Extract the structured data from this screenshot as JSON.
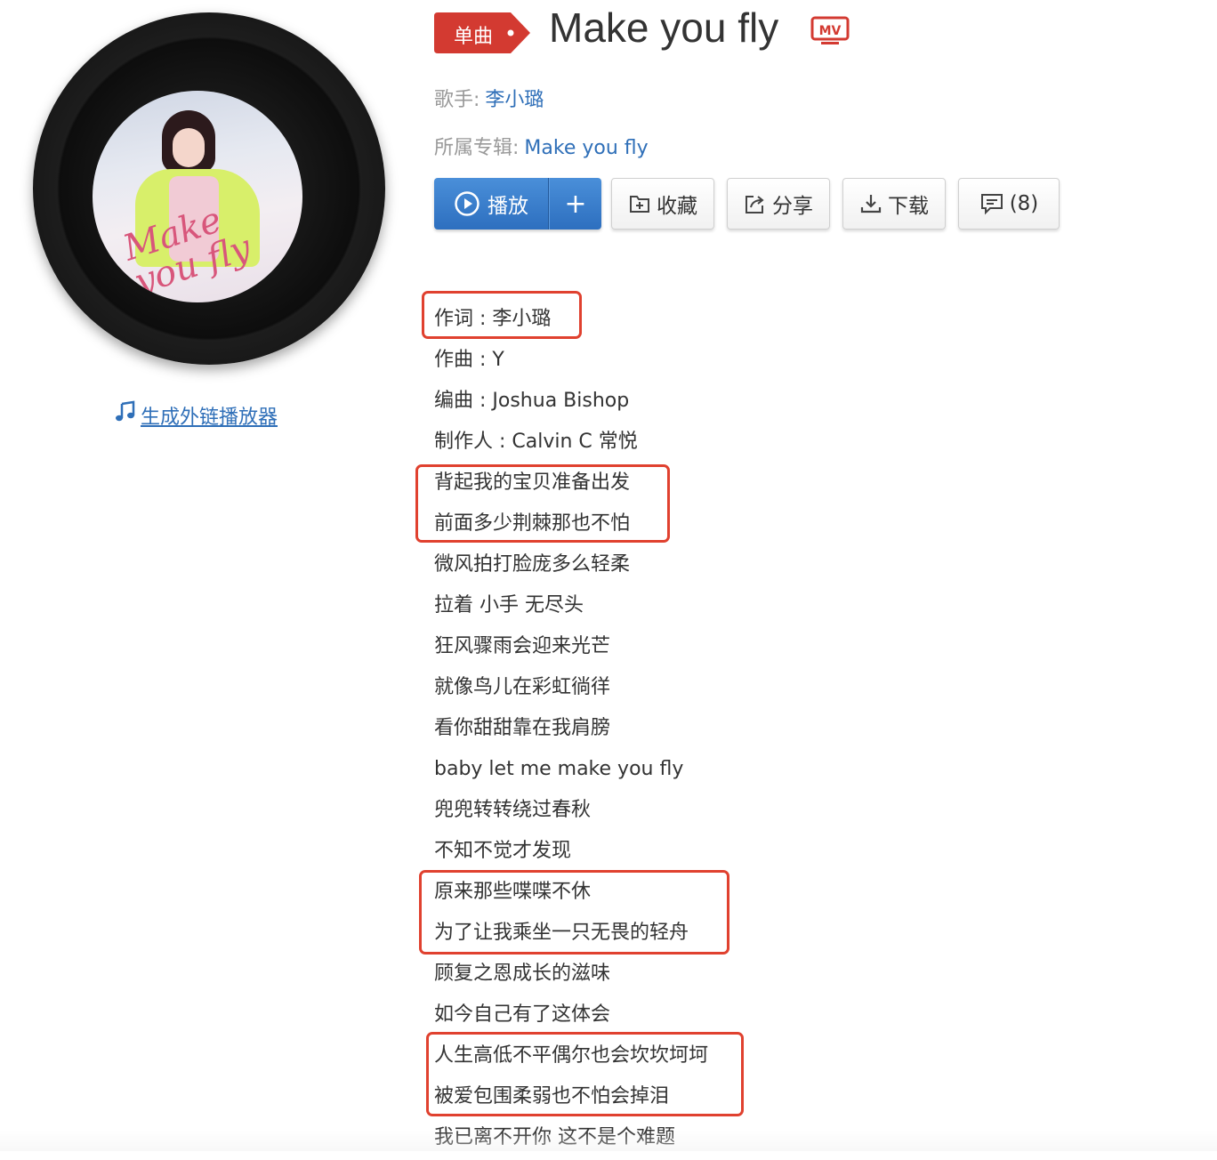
{
  "song": {
    "badge": "单曲",
    "title": "Make you fly",
    "mv_icon": "mv-icon",
    "singer_label": "歌手:",
    "singer": "李小璐",
    "album_label": "所属专辑:",
    "album": "Make you fly"
  },
  "cover": {
    "script_text": "Make you fly"
  },
  "left": {
    "player_link": "生成外链播放器",
    "player_link_icon": "music-note-icon"
  },
  "buttons": {
    "play": "播放",
    "add": "+",
    "favorite": "收藏",
    "share": "分享",
    "download": "下载",
    "comments": "(8)"
  },
  "colors": {
    "accent_blue": "#2f6fb8",
    "badge_red": "#d33a31",
    "highlight_red": "#e0412f"
  },
  "lyrics": [
    "作词 : 李小璐",
    "作曲 : Y",
    "编曲 : Joshua Bishop",
    "制作人 : Calvin C 常悦",
    "背起我的宝贝准备出发",
    "前面多少荆棘那也不怕",
    "微风拍打脸庞多么轻柔",
    "拉着 小手 无尽头",
    "狂风骤雨会迎来光芒",
    "就像鸟儿在彩虹徜徉",
    "看你甜甜靠在我肩膀",
    "baby let me make you fly",
    "兜兜转转绕过春秋",
    "不知不觉才发现",
    "原来那些喋喋不休",
    "为了让我乘坐一只无畏的轻舟",
    "顾复之恩成长的滋味",
    "如今自己有了这体会",
    "人生高低不平偶尔也会坎坎坷坷",
    "被爱包围柔弱也不怕会掉泪",
    "我已离不开你 这不是个难题"
  ]
}
